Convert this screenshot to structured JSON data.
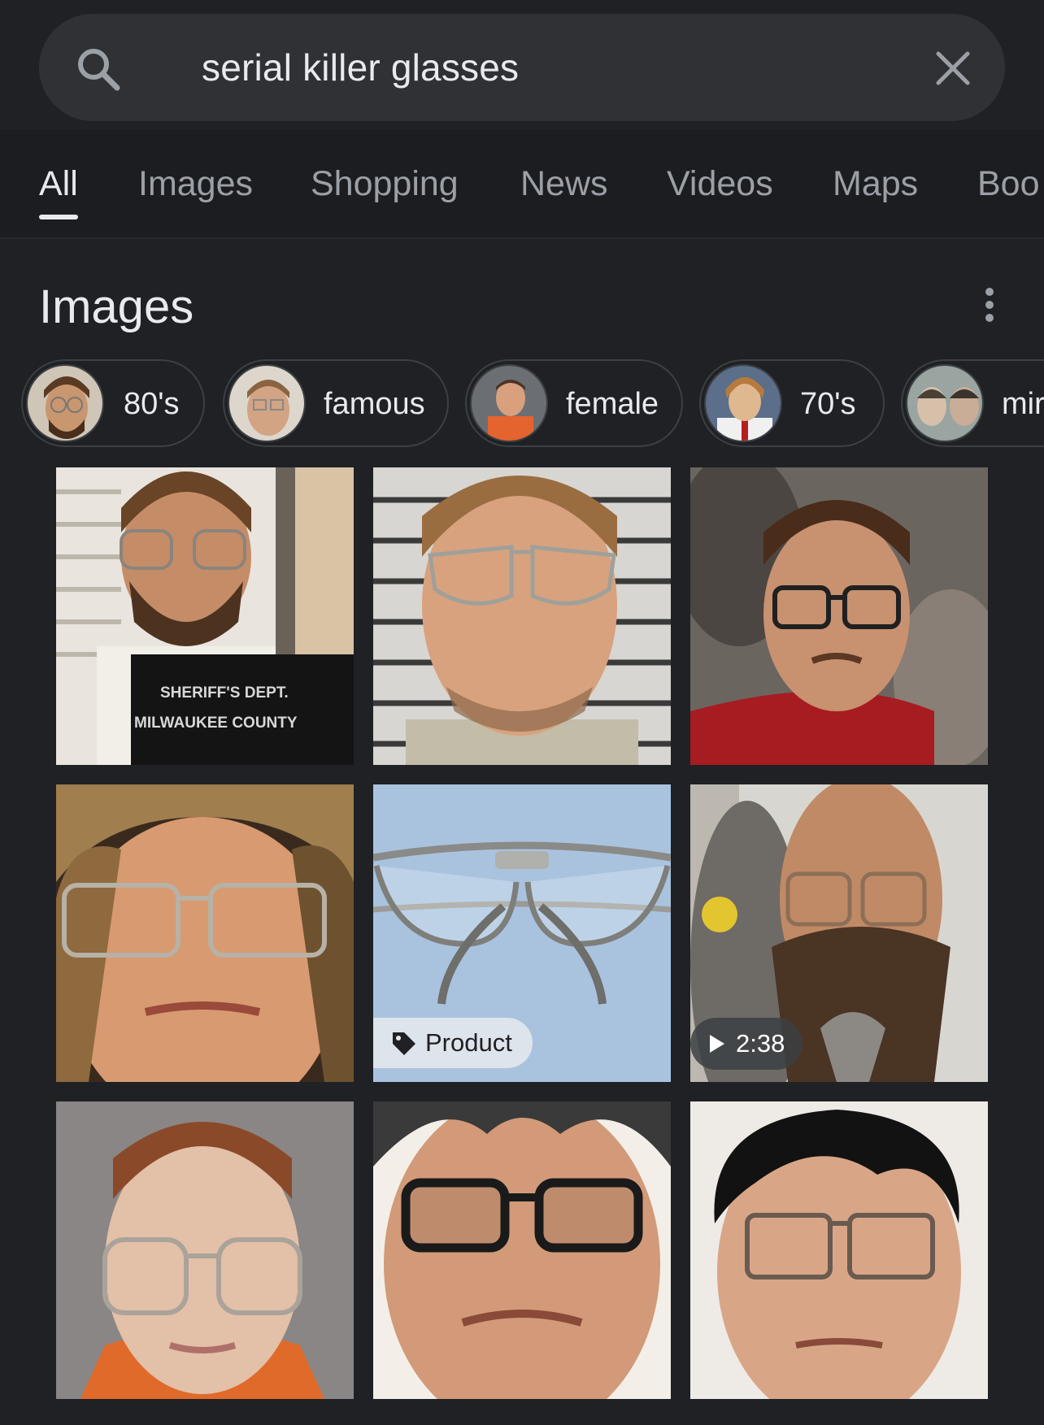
{
  "search": {
    "query": "serial killer glasses"
  },
  "tabs": [
    {
      "label": "All",
      "active": true
    },
    {
      "label": "Images"
    },
    {
      "label": "Shopping"
    },
    {
      "label": "News"
    },
    {
      "label": "Videos"
    },
    {
      "label": "Maps"
    },
    {
      "label": "Boo"
    }
  ],
  "images_section": {
    "title": "Images",
    "chips": [
      {
        "label": "80's"
      },
      {
        "label": "famous"
      },
      {
        "label": "female"
      },
      {
        "label": "70's"
      },
      {
        "label": "mir"
      }
    ],
    "grid": [
      {
        "type": "mugshot",
        "sign_line1": "SHERIFF'S DEPT.",
        "sign_line2": "MILWAUKEE COUNTY"
      },
      {
        "type": "mugshot"
      },
      {
        "type": "photo"
      },
      {
        "type": "photo"
      },
      {
        "type": "product",
        "badge": "Product",
        "badge_icon": "tag-icon"
      },
      {
        "type": "video",
        "badge": "2:38",
        "badge_icon": "play-icon"
      },
      {
        "type": "photo"
      },
      {
        "type": "photo"
      },
      {
        "type": "photo"
      }
    ]
  },
  "colors": {
    "background": "#1f2125",
    "search_bar": "#303134",
    "text_primary": "#e8eaed",
    "text_secondary": "#9aa0a6"
  }
}
